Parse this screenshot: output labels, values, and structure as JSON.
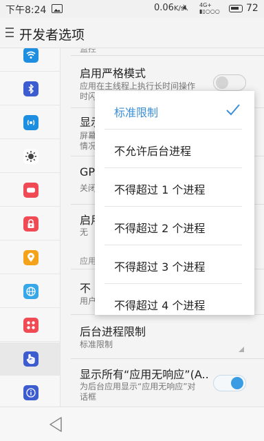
{
  "status_bar": {
    "time": "下午8:24",
    "data_speed": "0.06",
    "data_unit": "K/s",
    "network": "4G+",
    "battery": "72"
  },
  "header": {
    "title": "开发者选项"
  },
  "sidebar": {
    "items": [
      {
        "icon": "wifi-icon",
        "color": "#1e8fe0"
      },
      {
        "icon": "bluetooth-icon",
        "color": "#3d5ccf"
      },
      {
        "icon": "hotspot-icon",
        "color": "#1e8fe0"
      },
      {
        "icon": "brightness-icon",
        "color": "#ffffff"
      },
      {
        "icon": "display-icon",
        "color": "#f04a55"
      },
      {
        "icon": "lock-icon",
        "color": "#f04a55"
      },
      {
        "icon": "location-icon",
        "color": "#f4a21a"
      },
      {
        "icon": "globe-icon",
        "color": "#36a7e8"
      },
      {
        "icon": "apps-icon",
        "color": "#f04a55"
      },
      {
        "icon": "gesture-icon",
        "color": "#3d5ccf"
      },
      {
        "icon": "info-icon",
        "color": "#3d5ccf"
      }
    ],
    "active_index": 9
  },
  "content": {
    "section_top": "监控",
    "strict_mode": {
      "title": "启用严格模式",
      "subtitle_line1": "应用在主线程上执行长时间操作",
      "subtitle_line2": "时闪",
      "enabled": false
    },
    "show_cpu": {
      "title": "显示",
      "sub_line1": "屏幕",
      "sub_line2": "情况"
    },
    "gpu": {
      "title": "GP",
      "sub": "关闭"
    },
    "enable_trace": {
      "title": "启用",
      "sub": "无"
    },
    "section_apps": "应用",
    "dont_keep": {
      "title": "不",
      "sub": "用户"
    },
    "bg_limit": {
      "title": "后台进程限制",
      "sub": "标准限制"
    },
    "show_anr": {
      "title": "显示所有“应用无响应”(A..",
      "subtitle_line1": "为后台应用显示“应用无响应”对",
      "subtitle_line2": "话框",
      "enabled": true
    }
  },
  "popup": {
    "options": [
      "标准限制",
      "不允许后台进程",
      "不得超过 1 个进程",
      "不得超过 2 个进程",
      "不得超过 3 个进程",
      "不得超过 4 个进程"
    ],
    "selected_index": 0,
    "accent": "#3a8fd6"
  }
}
